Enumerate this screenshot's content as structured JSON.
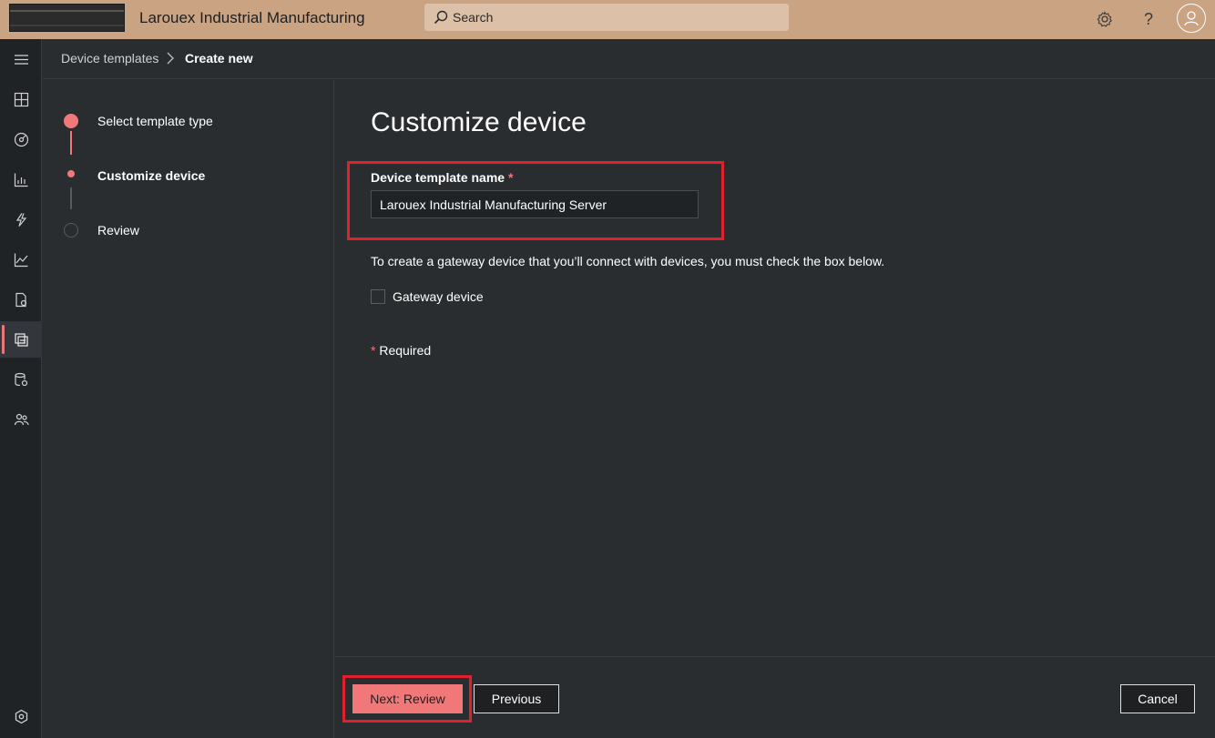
{
  "header": {
    "app_title": "Larouex Industrial Manufacturing",
    "search_placeholder": "Search",
    "help_glyph": "?"
  },
  "rail": {
    "icons": [
      "menu-icon",
      "dashboard-icon",
      "devices-icon",
      "analytics-icon",
      "rules-icon",
      "insights-icon",
      "jobs-icon",
      "device-templates-icon",
      "data-export-icon",
      "administration-icon",
      "settings-hub-icon"
    ],
    "active": "device-templates-icon"
  },
  "breadcrumb": {
    "parent": "Device templates",
    "current": "Create new"
  },
  "stepper": {
    "steps": [
      {
        "label": "Select template type",
        "state": "complete"
      },
      {
        "label": "Customize device",
        "state": "current"
      },
      {
        "label": "Review",
        "state": "upcoming"
      }
    ]
  },
  "form": {
    "title": "Customize device",
    "name_label": "Device template name",
    "required_star": "*",
    "name_value": "Larouex Industrial Manufacturing Server",
    "hint": "To create a gateway device that you’ll connect with devices, you must check the box below.",
    "gateway_label": "Gateway device",
    "gateway_checked": false,
    "required_note": "Required"
  },
  "footer": {
    "next_label": "Next: Review",
    "previous_label": "Previous",
    "cancel_label": "Cancel"
  },
  "colors": {
    "accent": "#f07878",
    "header_bg": "#c9a382",
    "highlight": "#e0202a",
    "page_bg": "#2a2d30"
  }
}
